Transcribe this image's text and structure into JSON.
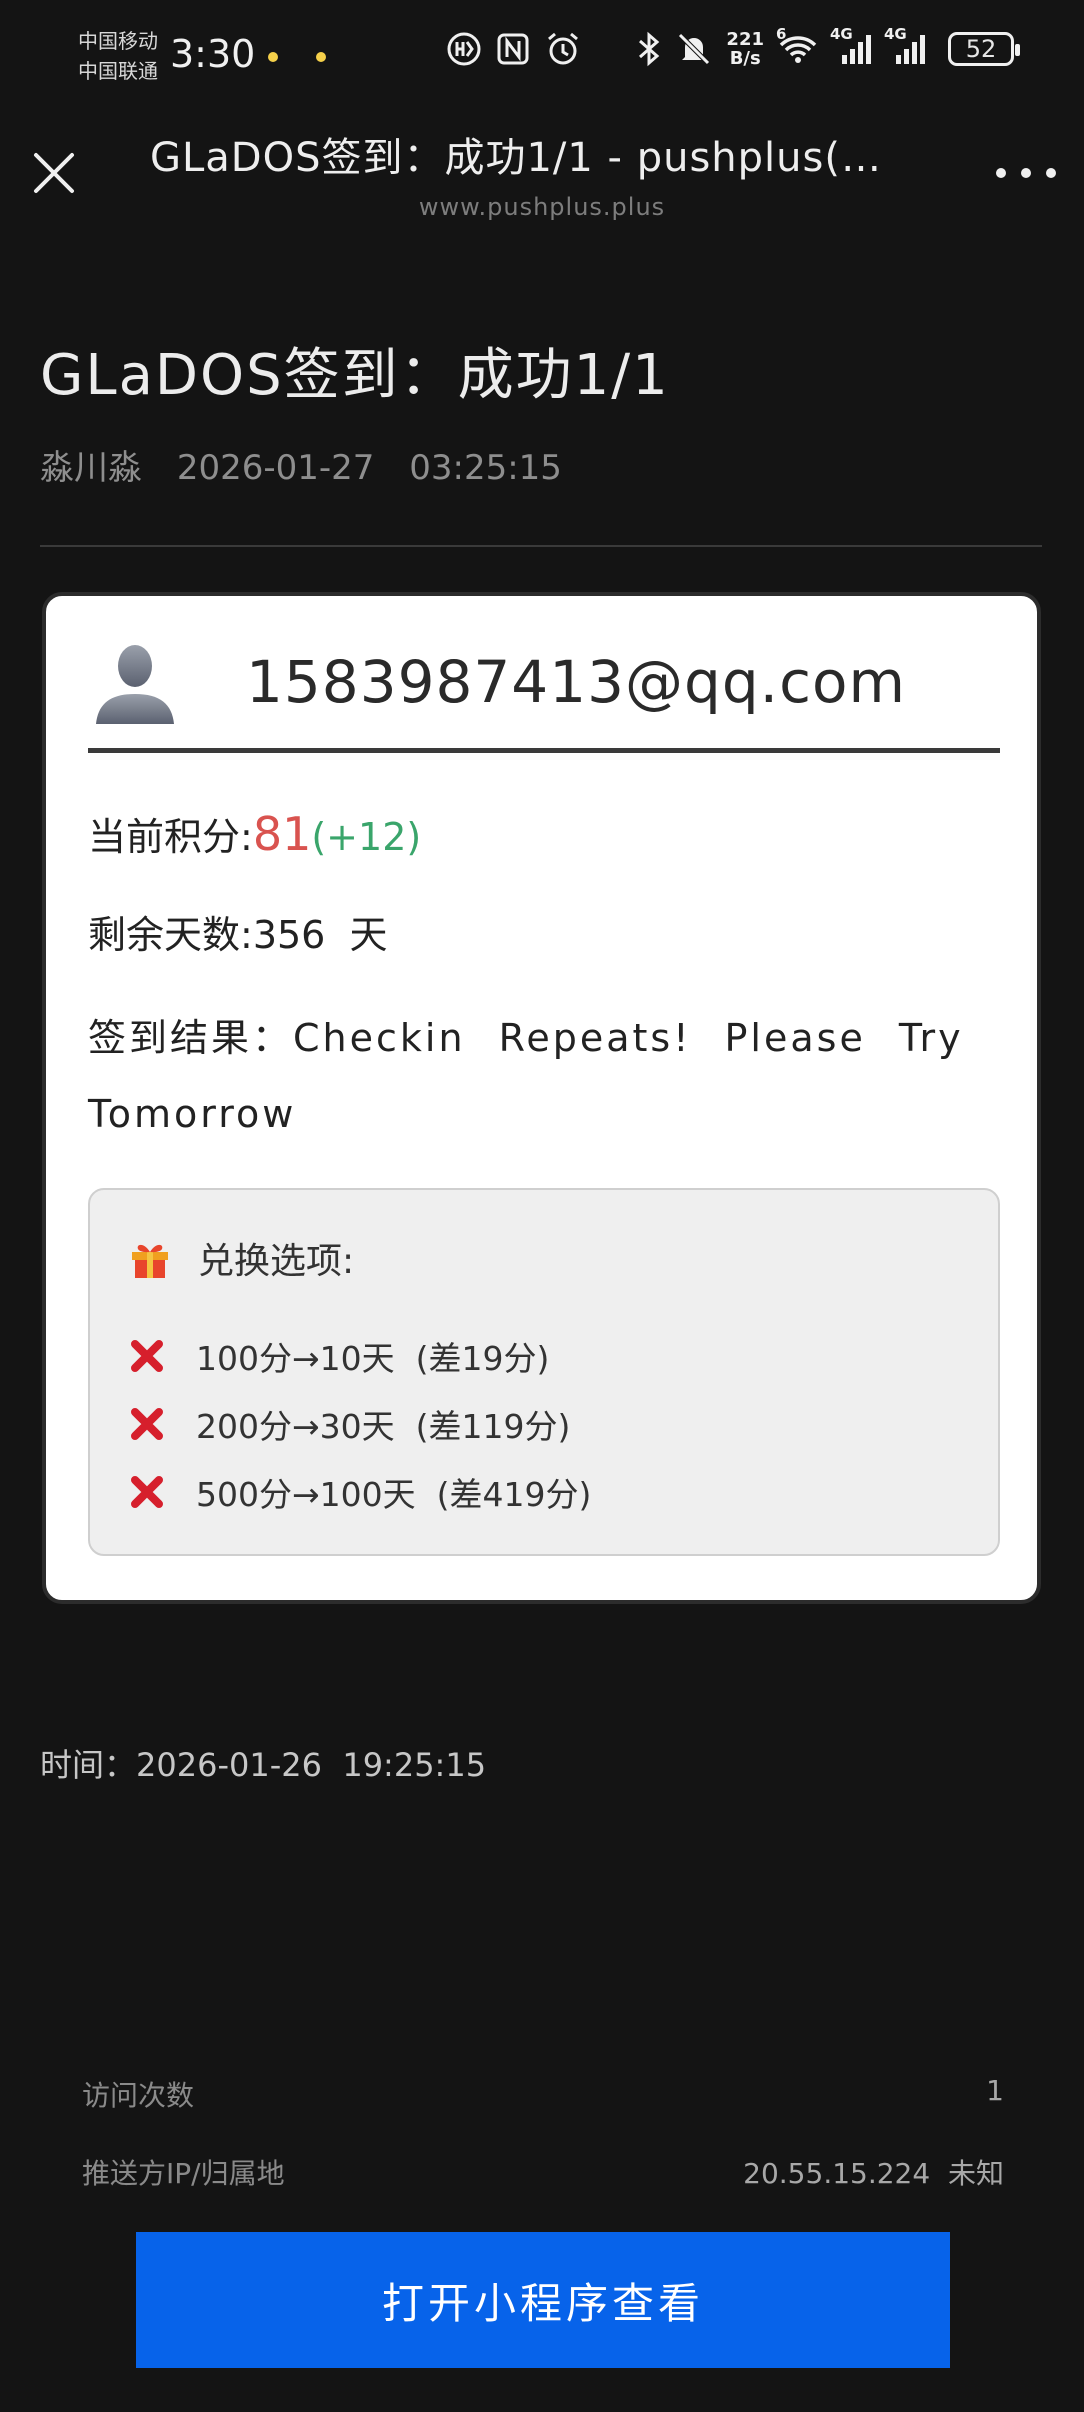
{
  "status_bar": {
    "carrier1": "中国移动",
    "carrier2": "中国联通",
    "time": "3:30",
    "net_speed_value": "221",
    "net_speed_unit": "B/s",
    "wifi_gen": "6",
    "signal1_label": "4G",
    "signal2_label": "4G",
    "battery": "52",
    "icons": [
      "hd-icon",
      "nfc-icon",
      "alarm-icon",
      "bluetooth-icon",
      "mute-icon",
      "wifi-icon",
      "signal-icon",
      "battery-icon"
    ]
  },
  "nav": {
    "title": "GLaDOS签到：成功1/1 - pushplus(…",
    "subtitle": "www.pushplus.plus"
  },
  "article": {
    "title": "GLaDOS签到：成功1/1",
    "author": "淼川淼",
    "date": "2026-01-27",
    "clock": "03:25:15"
  },
  "card": {
    "email": "1583987413@qq.com",
    "points_label": "当前积分:",
    "points_value": "81",
    "points_delta": "(+12)",
    "days_label": "剩余天数:",
    "days_value": "356",
    "days_unit": "天",
    "result_label": "签到结果：",
    "result_value": "Checkin Repeats! Please Try Tomorrow",
    "exchange": {
      "title": "兑换选项:",
      "items": [
        {
          "text": "100分→10天",
          "note": "(差19分)"
        },
        {
          "text": "200分→30天",
          "note": "(差119分)"
        },
        {
          "text": "500分→100天",
          "note": "(差419分)"
        }
      ]
    }
  },
  "footer": {
    "time_label": "时间：",
    "time_value": "2026-01-26  19:25:15",
    "visits_label": "访问次数",
    "visits_value": "1",
    "ip_label": "推送方IP/归属地",
    "ip_value": "20.55.15.224  未知",
    "open_button": "打开小程序查看"
  },
  "colors": {
    "background": "#141414",
    "points": "#d9534f",
    "delta": "#3aa56b",
    "button": "#0763ea"
  }
}
